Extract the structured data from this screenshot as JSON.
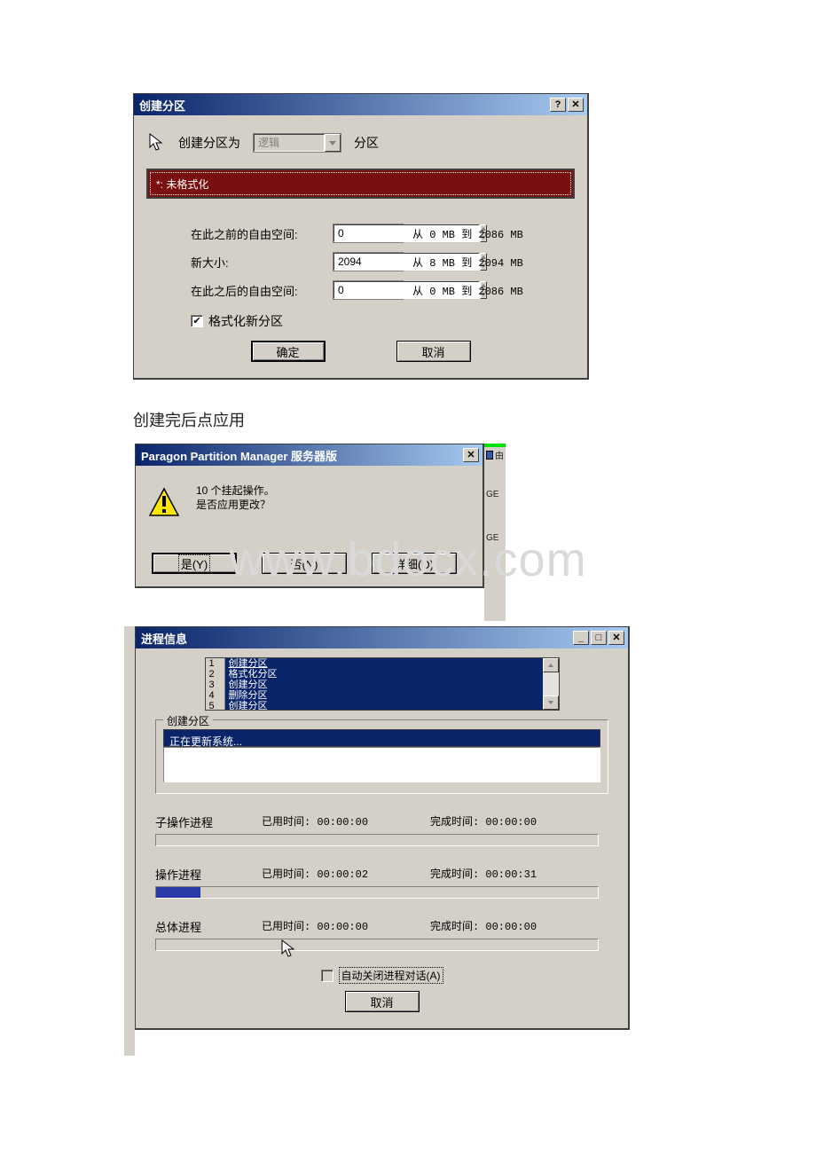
{
  "watermark": "www.bdocx.com",
  "dlg1": {
    "title": "创建分区",
    "help_glyph": "?",
    "close_glyph": "✕",
    "label_create_as": "创建分区为",
    "combo_value": "逻辑",
    "label_partition": "分区",
    "bar_text": "*: 未格式化",
    "row_before_label": "在此之前的自由空间:",
    "row_before_value": "0",
    "row_before_range": "从 0 MB 到 2086 MB",
    "row_size_label": "新大小:",
    "row_size_value": "2094",
    "row_size_range": "从 8 MB 到 2094 MB",
    "row_after_label": "在此之后的自由空间:",
    "row_after_value": "0",
    "row_after_range": "从 0 MB 到 2086 MB",
    "chk_format_label": "格式化新分区",
    "chk_format_checked": "✔",
    "btn_ok": "确定",
    "btn_cancel": "取消"
  },
  "caption": "创建完后点应用",
  "dlg2": {
    "title": "Paragon Partition Manager 服务器版",
    "close_glyph": "✕",
    "line1": "10 个挂起操作。",
    "line2": "是否应用更改？",
    "btn_yes": "是(Y)",
    "btn_no": "否(N)",
    "btn_details": "详细(D)"
  },
  "strip": {
    "t1": "由",
    "t2": "GE",
    "t3": "GE"
  },
  "dlg3": {
    "title": "进程信息",
    "min_glyph": "_",
    "max_glyph": "□",
    "close_glyph": "✕",
    "list_idx": [
      "1",
      "2",
      "3",
      "4",
      "5"
    ],
    "list_items": [
      "创建分区",
      "格式化分区",
      "创建分区",
      "删除分区",
      "创建分区"
    ],
    "group_label": "创建分区",
    "status_text": "正在更新系统...",
    "sub_label": "子操作进程",
    "sub_elapsed_lbl": "已用时间:",
    "sub_elapsed": "00:00:00",
    "sub_finish_lbl": "完成时间:",
    "sub_finish": "00:00:00",
    "sub_fill_pct": 0,
    "op_label": "操作进程",
    "op_elapsed_lbl": "已用时间:",
    "op_elapsed": "00:00:02",
    "op_finish_lbl": "完成时间:",
    "op_finish": "00:00:31",
    "op_fill_pct": 10,
    "total_label": "总体进程",
    "total_elapsed_lbl": "已用时间:",
    "total_elapsed": "00:00:00",
    "total_finish_lbl": "完成时间:",
    "total_finish": "00:00:00",
    "total_fill_pct": 0,
    "auto_close_label": "自动关闭进程对话(A)",
    "btn_cancel": "取消"
  }
}
